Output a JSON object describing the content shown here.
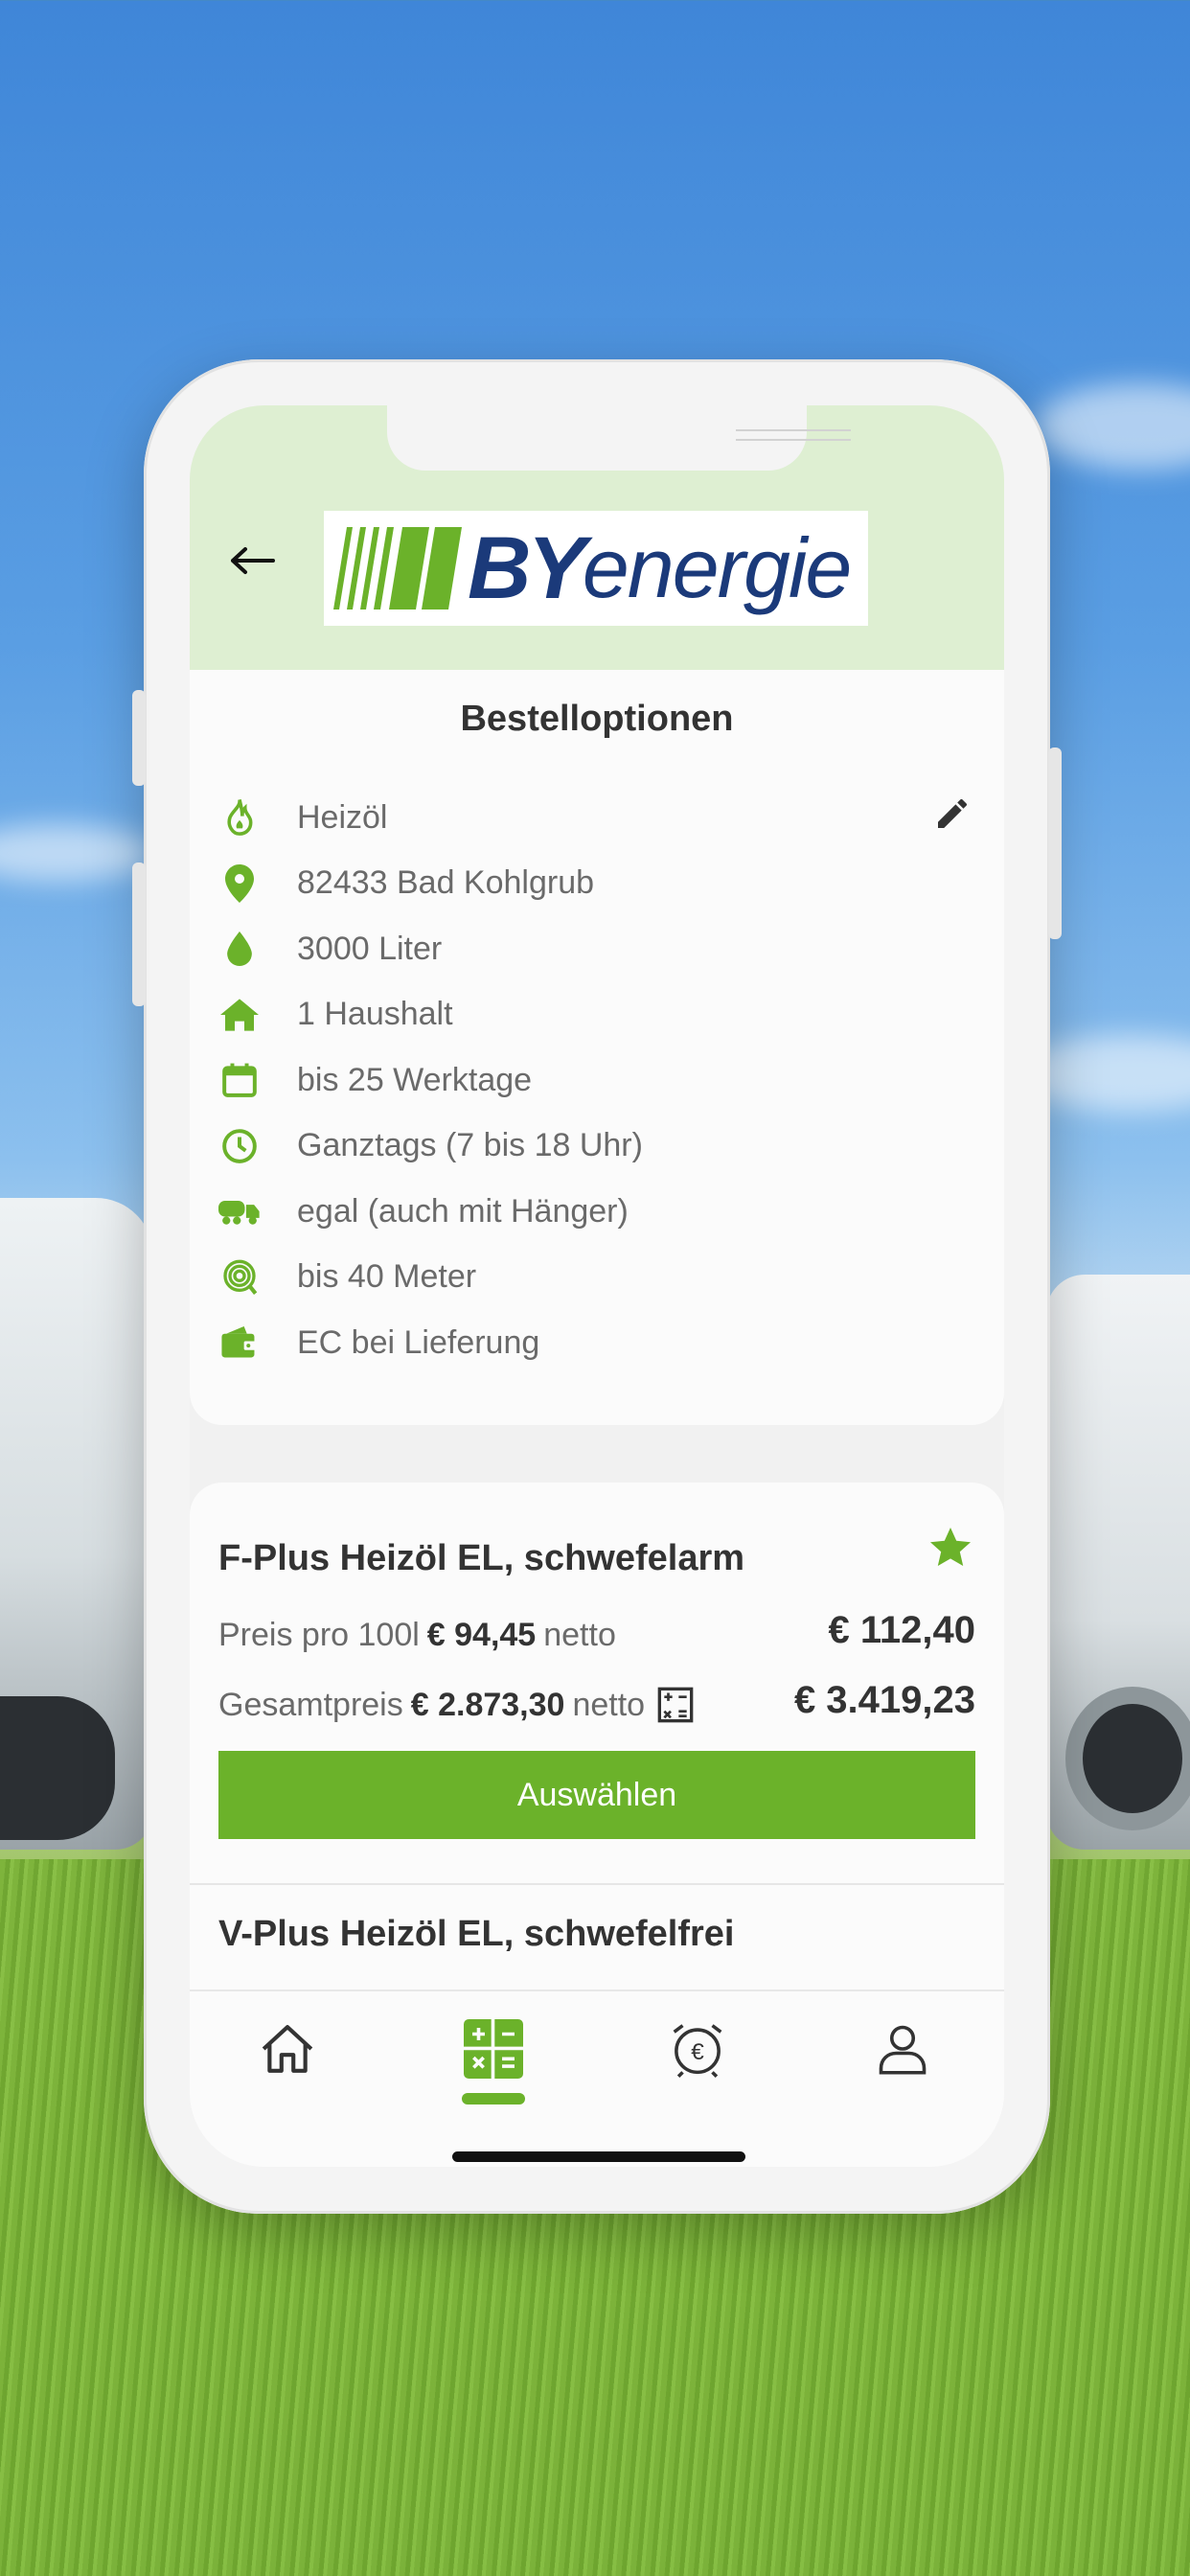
{
  "header": {
    "logo_text_by": "BY",
    "logo_text_energie": "energie"
  },
  "options": {
    "title": "Bestelloptionen",
    "items": [
      {
        "icon": "flame-icon",
        "label": "Heizöl"
      },
      {
        "icon": "location-pin-icon",
        "label": "82433 Bad Kohlgrub"
      },
      {
        "icon": "drop-icon",
        "label": "3000 Liter"
      },
      {
        "icon": "house-icon",
        "label": "1 Haushalt"
      },
      {
        "icon": "calendar-icon",
        "label": "bis 25 Werktage"
      },
      {
        "icon": "clock-icon",
        "label": "Ganztags (7 bis 18 Uhr)"
      },
      {
        "icon": "truck-icon",
        "label": "egal (auch mit Hänger)"
      },
      {
        "icon": "hose-icon",
        "label": "bis 40 Meter"
      },
      {
        "icon": "wallet-icon",
        "label": "EC bei Lieferung"
      }
    ]
  },
  "products": [
    {
      "name": "F-Plus Heizöl EL, schwefelarm",
      "price_per_label": "Preis pro 100l",
      "price_per_net": "€ 94,45",
      "netto_word": "netto",
      "price_per_gross": "€ 112,40",
      "total_label": "Gesamtpreis",
      "total_net": "€ 2.873,30",
      "total_gross": "€ 3.419,23",
      "button": "Auswählen"
    },
    {
      "name": "V-Plus Heizöl EL, schwefelfrei"
    }
  ],
  "colors": {
    "accent": "#6bb22a",
    "header_bg": "#deefd2",
    "brand_blue": "#1b3a7a"
  }
}
